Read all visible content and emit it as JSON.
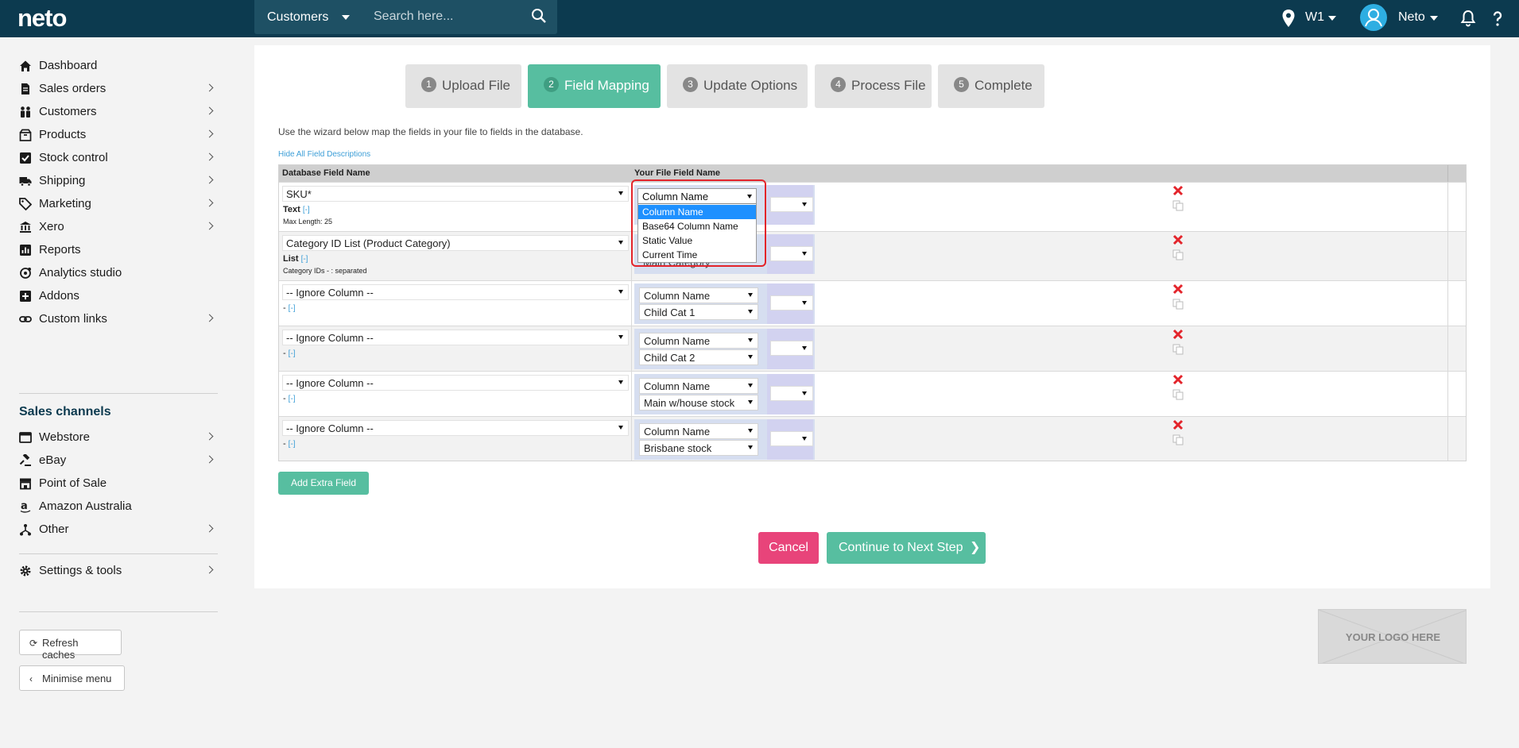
{
  "topbar": {
    "logo": "neto",
    "search_scope": "Customers",
    "search_placeholder": "Search here...",
    "location": "W1",
    "user": "Neto"
  },
  "sidebar": {
    "items": [
      {
        "label": "Dashboard",
        "icon": "home-icon",
        "chevron": false
      },
      {
        "label": "Sales orders",
        "icon": "file-icon",
        "chevron": true
      },
      {
        "label": "Customers",
        "icon": "people-icon",
        "chevron": true
      },
      {
        "label": "Products",
        "icon": "box-icon",
        "chevron": true
      },
      {
        "label": "Stock control",
        "icon": "checkbox-icon",
        "chevron": true
      },
      {
        "label": "Shipping",
        "icon": "truck-icon",
        "chevron": true
      },
      {
        "label": "Marketing",
        "icon": "tag-icon",
        "chevron": true
      },
      {
        "label": "Xero",
        "icon": "bank-icon",
        "chevron": true
      },
      {
        "label": "Reports",
        "icon": "bar-chart-icon",
        "chevron": false
      },
      {
        "label": "Analytics studio",
        "icon": "analytics-icon",
        "chevron": false
      },
      {
        "label": "Addons",
        "icon": "plus-square-icon",
        "chevron": false
      },
      {
        "label": "Custom links",
        "icon": "link-icon",
        "chevron": true
      }
    ],
    "channels_title": "Sales channels",
    "channels": [
      {
        "label": "Webstore",
        "icon": "browser-icon",
        "chevron": true
      },
      {
        "label": "eBay",
        "icon": "gavel-icon",
        "chevron": true
      },
      {
        "label": "Point of Sale",
        "icon": "store-icon",
        "chevron": false
      },
      {
        "label": "Amazon Australia",
        "icon": "amazon-icon",
        "chevron": false
      },
      {
        "label": "Other",
        "icon": "network-icon",
        "chevron": true
      }
    ],
    "settings": {
      "label": "Settings & tools",
      "icon": "gear-icon"
    },
    "refresh_label": "Refresh caches",
    "minimise_label": "Minimise menu"
  },
  "wizard": {
    "steps": [
      {
        "num": "1",
        "label": "Upload File",
        "active": false
      },
      {
        "num": "2",
        "label": "Field Mapping",
        "active": true
      },
      {
        "num": "3",
        "label": "Update Options",
        "active": false
      },
      {
        "num": "4",
        "label": "Process File",
        "active": false
      },
      {
        "num": "5",
        "label": "Complete",
        "active": false
      }
    ],
    "intro": "Use the wizard below map the fields in your file to fields in the database.",
    "hide_link": "Hide All Field Descriptions"
  },
  "table": {
    "headers": {
      "db": "Database Field Name",
      "file": "Your File Field Name"
    },
    "rows": [
      {
        "db": "SKU*",
        "type": "Text",
        "toggle": "[-]",
        "desc": "Max Length: 25",
        "mode": "Column Name",
        "value": ""
      },
      {
        "db": "Category ID List (Product Category)",
        "type": "List",
        "toggle": "[-]",
        "desc": "Category IDs - : separated",
        "mode": "Column Name",
        "value": "Main Category"
      },
      {
        "db": "-- Ignore Column --",
        "type": "-",
        "toggle": "[-]",
        "desc": "",
        "mode": "Column Name",
        "value": "Child Cat 1"
      },
      {
        "db": "-- Ignore Column --",
        "type": "-",
        "toggle": "[-]",
        "desc": "",
        "mode": "Column Name",
        "value": "Child Cat 2"
      },
      {
        "db": "-- Ignore Column --",
        "type": "-",
        "toggle": "[-]",
        "desc": "",
        "mode": "Column Name",
        "value": "Main w/house stock"
      },
      {
        "db": "-- Ignore Column --",
        "type": "-",
        "toggle": "[-]",
        "desc": "",
        "mode": "Column Name",
        "value": "Brisbane stock"
      }
    ]
  },
  "dropdown": {
    "current": "Column Name",
    "options": [
      "Column Name",
      "Base64 Column Name",
      "Static Value",
      "Current Time"
    ],
    "selected_index": 0
  },
  "buttons": {
    "add_field": "Add Extra Field",
    "cancel": "Cancel",
    "next": "Continue to Next Step"
  },
  "logo_placeholder": "YOUR LOGO HERE",
  "colors": {
    "brand": "#0c3a4f",
    "accent": "#57bea0",
    "danger": "#e8447a",
    "highlight": "#e3242b"
  }
}
